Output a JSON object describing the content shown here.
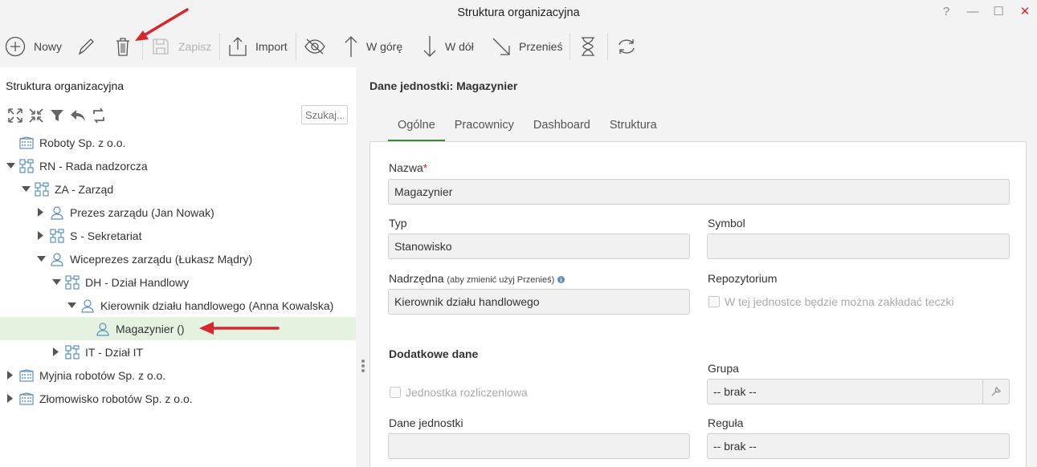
{
  "window": {
    "title": "Struktura organizacyjna",
    "controls": {
      "help": "?",
      "minimize": "—",
      "maximize": "☐",
      "close": "✕"
    }
  },
  "toolbar": {
    "new_label": "Nowy",
    "save_label": "Zapisz",
    "import_label": "Import",
    "up_label": "W górę",
    "down_label": "W dół",
    "move_label": "Przenieś"
  },
  "left": {
    "title": "Struktura organizacyjna",
    "search_placeholder": "Szukaj..."
  },
  "tree": [
    {
      "label": "Roboty Sp. z o.o.",
      "icon": "company-icon",
      "depth": 0,
      "arrow": "none"
    },
    {
      "label": "RN - Rada nadzorcza",
      "icon": "org-unit-icon",
      "depth": 0,
      "arrow": "expanded"
    },
    {
      "label": "ZA - Zarząd",
      "icon": "org-unit-icon",
      "depth": 1,
      "arrow": "expanded"
    },
    {
      "label": "Prezes zarządu (Jan Nowak)",
      "icon": "person-icon",
      "depth": 2,
      "arrow": "collapsed"
    },
    {
      "label": "S - Sekretariat",
      "icon": "org-unit-icon",
      "depth": 2,
      "arrow": "collapsed"
    },
    {
      "label": "Wiceprezes zarządu (Łukasz Mądry)",
      "icon": "person-icon",
      "depth": 2,
      "arrow": "expanded"
    },
    {
      "label": "DH - Dział Handlowy",
      "icon": "org-unit-icon",
      "depth": 3,
      "arrow": "expanded"
    },
    {
      "label": "Kierownik działu handlowego (Anna Kowalska)",
      "icon": "person-icon",
      "depth": 4,
      "arrow": "expanded"
    },
    {
      "label": "Magazynier ()",
      "icon": "person-icon",
      "depth": 5,
      "arrow": "none",
      "selected": true
    },
    {
      "label": "IT - Dział IT",
      "icon": "org-unit-icon",
      "depth": 3,
      "arrow": "collapsed"
    },
    {
      "label": "Myjnia robotów Sp. z o.o.",
      "icon": "company-icon",
      "depth": 0,
      "arrow": "collapsed"
    },
    {
      "label": "Złomowisko robotów Sp. z o.o.",
      "icon": "company-icon",
      "depth": 0,
      "arrow": "collapsed"
    }
  ],
  "right": {
    "title": "Dane jednostki: Magazynier",
    "tabs": [
      "Ogólne",
      "Pracownicy",
      "Dashboard",
      "Struktura"
    ],
    "active_tab": "Ogólne",
    "form": {
      "name_label": "Nazwa",
      "required_mark": "*",
      "name_value": "Magazynier",
      "type_label": "Typ",
      "type_value": "Stanowisko",
      "symbol_label": "Symbol",
      "symbol_value": "",
      "parent_label": "Nadrzędna",
      "parent_hint": "(aby zmienić użyj Przenieś)",
      "parent_value": "Kierownik działu handlowego",
      "repo_label": "Repozytorium",
      "repo_checkbox": "W tej jednostce będzie można zakładać teczki",
      "additional_section": "Dodatkowe dane",
      "group_label": "Grupa",
      "group_value": "-- brak --",
      "settlement_checkbox": "Jednostka rozliczeniowa",
      "unit_data_label": "Dane jednostki",
      "unit_data_value": "",
      "rule_label": "Reguła",
      "rule_value": "-- brak --"
    }
  },
  "colors": {
    "accent_green": "#3a8a3a",
    "selected_row": "#e6f2e0",
    "annotation_red": "#d9262e",
    "icon_blue": "#5b8fc7"
  }
}
